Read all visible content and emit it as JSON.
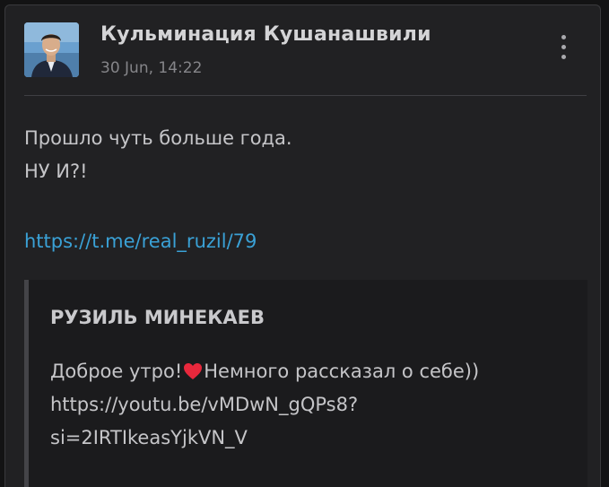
{
  "post": {
    "author": "Кульминация Кушанашвили",
    "timestamp": "30 Jun, 14:22",
    "avatar_icon": "user-avatar-photo",
    "menu_icon": "more-vertical-icon",
    "lines": [
      "Прошло чуть больше года.",
      "НУ И?!"
    ],
    "link": "https://t.me/real_ruzil/79"
  },
  "quote": {
    "author": "РУЗИЛЬ МИНЕКАЕВ",
    "text_before_heart": "Доброе утро!",
    "heart_icon": "red-heart-emoji",
    "text_after_heart": "Немного рассказал о себе))",
    "url_line1": "https://youtu.be/vMDwN_gQPs8?",
    "url_line2": "si=2IRTIkeasYjkVN_V"
  },
  "colors": {
    "card_background": "#212123",
    "page_background": "#131314",
    "link": "#3aa1d6",
    "heart": "#e8283c"
  }
}
